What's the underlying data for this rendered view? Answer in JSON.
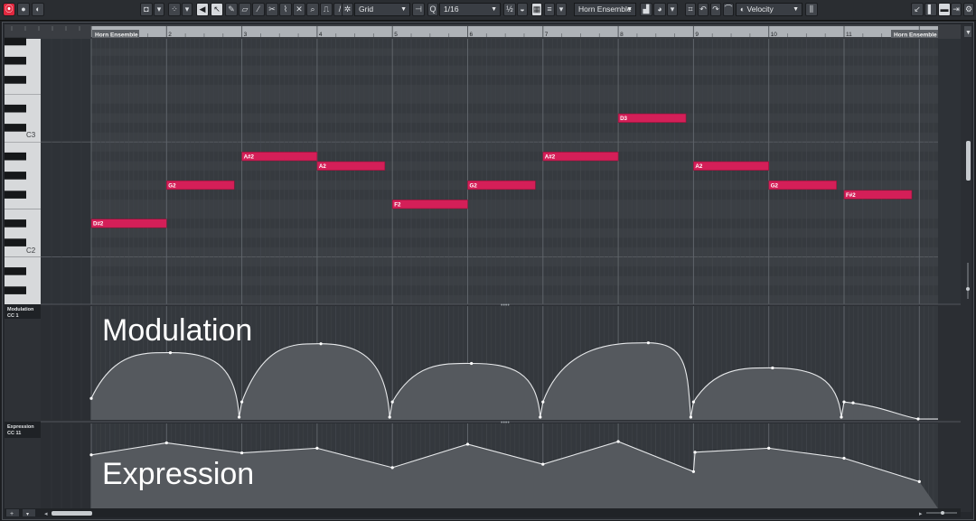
{
  "toolbar": {
    "record_button": "⦿",
    "grid_type": "Grid",
    "quantize": "1/16",
    "track": "Horn Ensemble",
    "controller": "Velocity"
  },
  "ruler": {
    "bars": [
      "2",
      "3",
      "4",
      "5",
      "6",
      "7",
      "8",
      "9",
      "10",
      "11"
    ],
    "start_marker": "Horn Ensemble",
    "end_marker": "Horn Ensemble"
  },
  "keyboard": {
    "labels": [
      "C3",
      "C2"
    ]
  },
  "notes": [
    {
      "label": "D#2",
      "bar": 1.0,
      "end": 2.0,
      "pitch": "D#2"
    },
    {
      "label": "G2",
      "bar": 2.0,
      "end": 2.9,
      "pitch": "G2"
    },
    {
      "label": "A#2",
      "bar": 3.0,
      "end": 4.0,
      "pitch": "A#2"
    },
    {
      "label": "A2",
      "bar": 4.0,
      "end": 4.9,
      "pitch": "A2"
    },
    {
      "label": "F2",
      "bar": 5.0,
      "end": 6.0,
      "pitch": "F2"
    },
    {
      "label": "G2",
      "bar": 6.0,
      "end": 6.9,
      "pitch": "G2"
    },
    {
      "label": "A#2",
      "bar": 7.0,
      "end": 8.0,
      "pitch": "A#2"
    },
    {
      "label": "D3",
      "bar": 8.0,
      "end": 8.9,
      "pitch": "D3"
    },
    {
      "label": "A2",
      "bar": 9.0,
      "end": 10.0,
      "pitch": "A2"
    },
    {
      "label": "G2",
      "bar": 10.0,
      "end": 10.9,
      "pitch": "G2"
    },
    {
      "label": "F#2",
      "bar": 11.0,
      "end": 11.9,
      "pitch": "F#2"
    }
  ],
  "lanes": {
    "modulation": {
      "name": "Modulation",
      "cc": "CC 1",
      "big_label": "Modulation"
    },
    "expression": {
      "name": "Expression",
      "cc": "CC 11",
      "big_label": "Expression"
    }
  },
  "colors": {
    "note": "#d41f58",
    "curve": "#e6e8ea",
    "fill": "#55595e"
  }
}
